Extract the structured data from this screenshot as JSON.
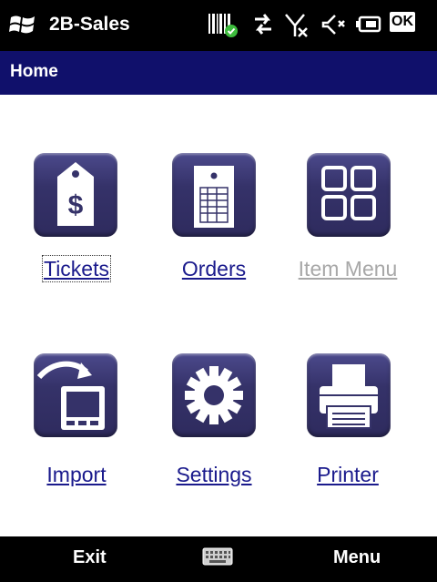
{
  "status_bar": {
    "app_title": "2B-Sales",
    "ok_label": "OK",
    "icons": [
      "windows-start-icon",
      "barcode-icon",
      "connectivity-icon",
      "no-signal-icon",
      "volume-mute-icon",
      "battery-icon"
    ]
  },
  "header": {
    "title": "Home"
  },
  "menu_items": [
    {
      "label": "Tickets",
      "icon": "price-tag-icon",
      "enabled": true
    },
    {
      "label": "Orders",
      "icon": "order-form-icon",
      "enabled": true
    },
    {
      "label": "Item Menu",
      "icon": "grid-icon",
      "enabled": false
    },
    {
      "label": "Import",
      "icon": "import-device-icon",
      "enabled": true
    },
    {
      "label": "Settings",
      "icon": "gear-icon",
      "enabled": true
    },
    {
      "label": "Printer",
      "icon": "printer-icon",
      "enabled": true
    }
  ],
  "bottom_bar": {
    "left_softkey": "Exit",
    "right_softkey": "Menu",
    "center_icon": "keyboard-icon"
  },
  "colors": {
    "title_bar": "#10106b",
    "tile": "#353269",
    "link": "#1a1a8c",
    "disabled": "#a8a8a8"
  }
}
